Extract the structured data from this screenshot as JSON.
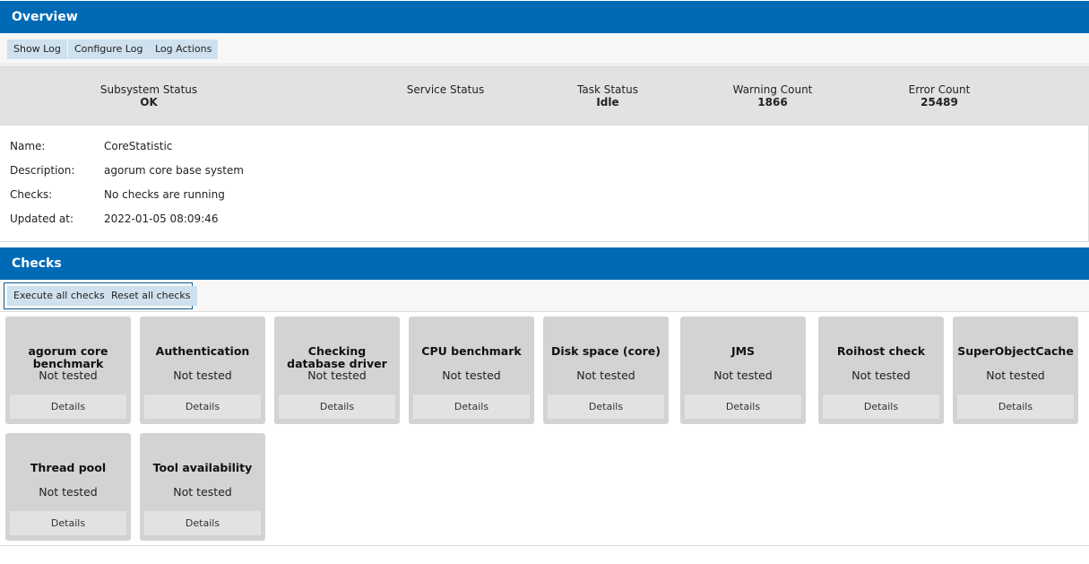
{
  "overview": {
    "header": "Overview",
    "toolbar": {
      "show_log": "Show Log",
      "configure_log": "Configure Log",
      "log_actions": "Log Actions"
    },
    "status": {
      "subsystem": {
        "label": "Subsystem Status",
        "value": "OK"
      },
      "service": {
        "label": "Service Status",
        "value": ""
      },
      "task": {
        "label": "Task Status",
        "value": "Idle"
      },
      "warning": {
        "label": "Warning Count",
        "value": "1866"
      },
      "error": {
        "label": "Error Count",
        "value": "25489"
      }
    },
    "info": {
      "name": {
        "label": "Name:",
        "value": "CoreStatistic"
      },
      "description": {
        "label": "Description:",
        "value": "agorum core base system"
      },
      "checks": {
        "label": "Checks:",
        "value": "No checks are running"
      },
      "updated": {
        "label": "Updated at:",
        "value": "2022-01-05 08:09:46"
      }
    }
  },
  "checks": {
    "header": "Checks",
    "toolbar": {
      "execute_all": "Execute all checks",
      "reset_all": "Reset all checks"
    },
    "details_label": "Details",
    "cards": [
      {
        "title": "agorum core benchmark",
        "state": "Not tested"
      },
      {
        "title": "Authentication",
        "state": "Not tested"
      },
      {
        "title": "Checking database driver",
        "state": "Not tested"
      },
      {
        "title": "CPU benchmark",
        "state": "Not tested"
      },
      {
        "title": "Disk space (core)",
        "state": "Not tested"
      },
      {
        "title": "JMS",
        "state": "Not tested"
      },
      {
        "title": "Roihost check",
        "state": "Not tested"
      },
      {
        "title": "SuperObjectCache",
        "state": "Not tested"
      },
      {
        "title": "Thread pool",
        "state": "Not tested"
      },
      {
        "title": "Tool availability",
        "state": "Not tested"
      }
    ]
  },
  "colors": {
    "header_blue": "#006ab5",
    "button_bg": "#cfe1ee",
    "card_bg": "#d3d3d3",
    "status_bar_bg": "#e2e2e2"
  }
}
